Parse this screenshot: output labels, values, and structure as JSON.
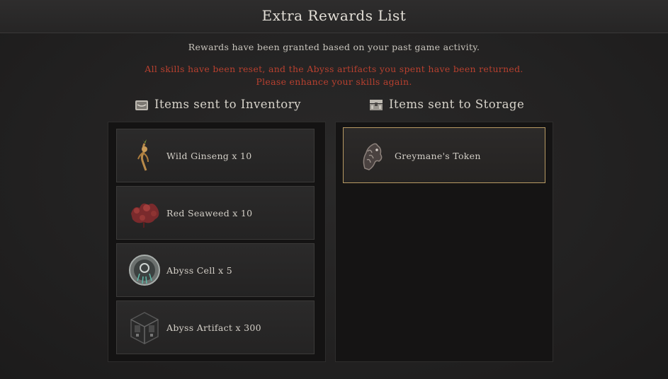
{
  "window": {
    "title": "Extra Rewards List"
  },
  "messages": {
    "info": "Rewards have been granted based on your past game activity.",
    "warning_line1": "All skills have been reset, and the Abyss artifacts you spent have been returned.",
    "warning_line2": "Please enhance your skills again."
  },
  "inventory": {
    "title": "Items sent to Inventory",
    "icon": "bag-icon",
    "items": [
      {
        "label": "Wild Ginseng x 10",
        "icon": "wild-ginseng-icon"
      },
      {
        "label": "Red Seaweed x 10",
        "icon": "red-seaweed-icon"
      },
      {
        "label": "Abyss Cell x 5",
        "icon": "abyss-cell-icon"
      },
      {
        "label": "Abyss Artifact x 300",
        "icon": "abyss-artifact-icon"
      }
    ]
  },
  "storage": {
    "title": "Items sent to Storage",
    "icon": "storage-chest-icon",
    "items": [
      {
        "label": "Greymane's Token",
        "icon": "horse-token-icon"
      }
    ]
  },
  "colors": {
    "warning_text": "#b8402f",
    "selected_border": "#b89a63",
    "background": "#232222"
  }
}
